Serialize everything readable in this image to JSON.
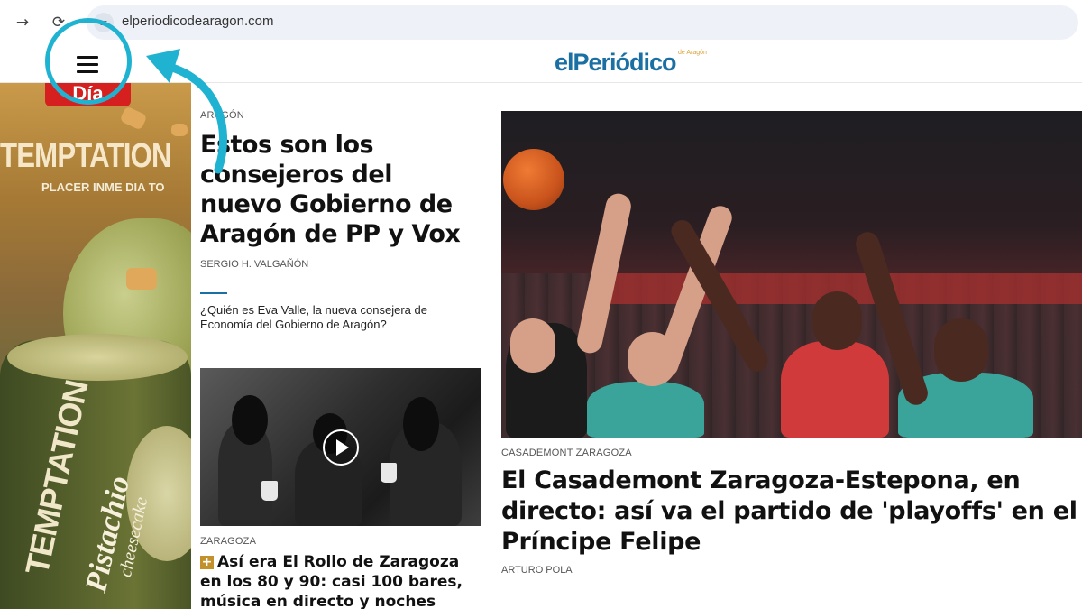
{
  "browser": {
    "url": "elperiodicodearagon.com",
    "forward_icon": "arrow-right-icon",
    "reload_icon": "reload-icon",
    "site_info_icon": "tune-icon"
  },
  "header": {
    "logo": "elPeriódico",
    "logo_sub": "de Aragón",
    "menu_icon": "hamburger-menu-icon"
  },
  "annotation": {
    "color": "#1fb3d1"
  },
  "ad": {
    "badge": "Día",
    "title": "TEMPTATION",
    "tagline": "PLACER INME DIA TO",
    "tub_brand": "TEMPTATION",
    "flavor": "Pistachio",
    "flavor_sub": "cheesecake"
  },
  "left_story": {
    "section": "ARAGÓN",
    "headline": "Estos son los consejeros del nuevo Gobierno de Aragón de PP y Vox",
    "author": "SERGIO H. VALGAÑÓN",
    "related": "¿Quién es Eva Valle, la nueva consejera de Economía del Gobierno de Aragón?"
  },
  "second_story": {
    "section": "ZARAGOZA",
    "headline": "Así era El Rollo de Zaragoza en los 80 y 90: casi 100 bares, música en directo y noches",
    "premium_icon": "plus-icon"
  },
  "main_story": {
    "section": "CASADEMONT ZARAGOZA",
    "headline": "El Casademont Zaragoza-Estepona, en directo: así va el partido de 'playoffs' en el Príncipe Felipe",
    "author": "ARTURO POLA"
  },
  "colors": {
    "brand_blue": "#1a6fa3",
    "premium_gold": "#c3912c"
  }
}
